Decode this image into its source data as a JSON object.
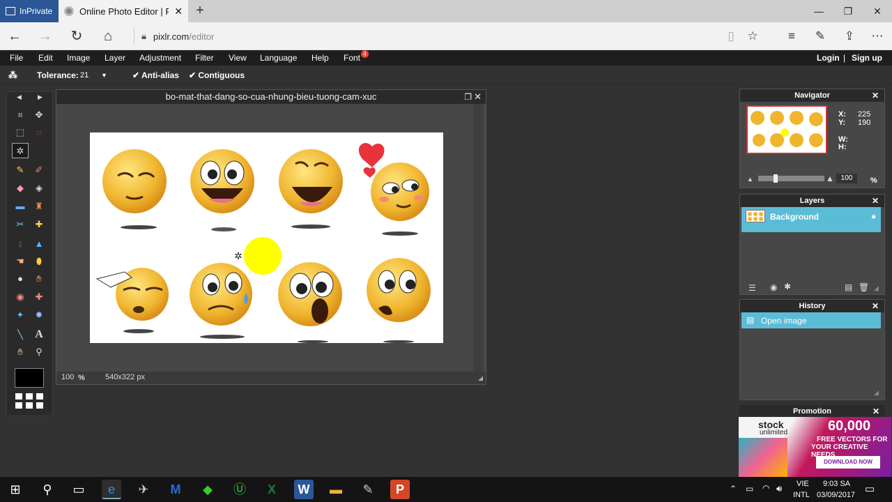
{
  "browser": {
    "inprivate_label": "InPrivate",
    "tab_title": "Online Photo Editor | Pi",
    "url_host": "pixlr.com",
    "url_path": "/editor"
  },
  "menu": {
    "items": [
      "File",
      "Edit",
      "Image",
      "Layer",
      "Adjustment",
      "Filter",
      "View",
      "Language",
      "Help",
      "Font"
    ],
    "font_badge": "4",
    "login": "Login",
    "separator": "|",
    "signup": "Sign up"
  },
  "options": {
    "tolerance_label": "Tolerance:",
    "tolerance_value": "21",
    "antialias_label": "Anti-alias",
    "contiguous_label": "Contiguous"
  },
  "image_window": {
    "title": "bo-mat-that-dang-so-cua-nhung-bieu-tuong-cam-xuc",
    "zoom": "100",
    "zoom_unit": "%",
    "dimensions": "540x322 px"
  },
  "navigator": {
    "title": "Navigator",
    "x_label": "X:",
    "x_value": "225",
    "y_label": "Y:",
    "y_value": "190",
    "w_label": "W:",
    "h_label": "H:",
    "zoom_value": "100",
    "zoom_unit": "%"
  },
  "layers": {
    "title": "Layers",
    "items": [
      "Background"
    ]
  },
  "history": {
    "title": "History",
    "items": [
      "Open image"
    ]
  },
  "promotion": {
    "title": "Promotion",
    "brand": "stock",
    "brand_sub": "unlimited",
    "count": "60,000",
    "line1": "FREE VECTORS FOR",
    "line2": "YOUR CREATIVE NEEDS",
    "cta": "DOWNLOAD NOW"
  },
  "taskbar": {
    "lang1": "VIE",
    "lang2": "INTL",
    "time": "9:03 SA",
    "date": "03/09/2017"
  },
  "colors": {
    "selection_blue": "#5bbcd6",
    "foreground_color": "#000000",
    "inprivate_blue": "#2b5797"
  }
}
